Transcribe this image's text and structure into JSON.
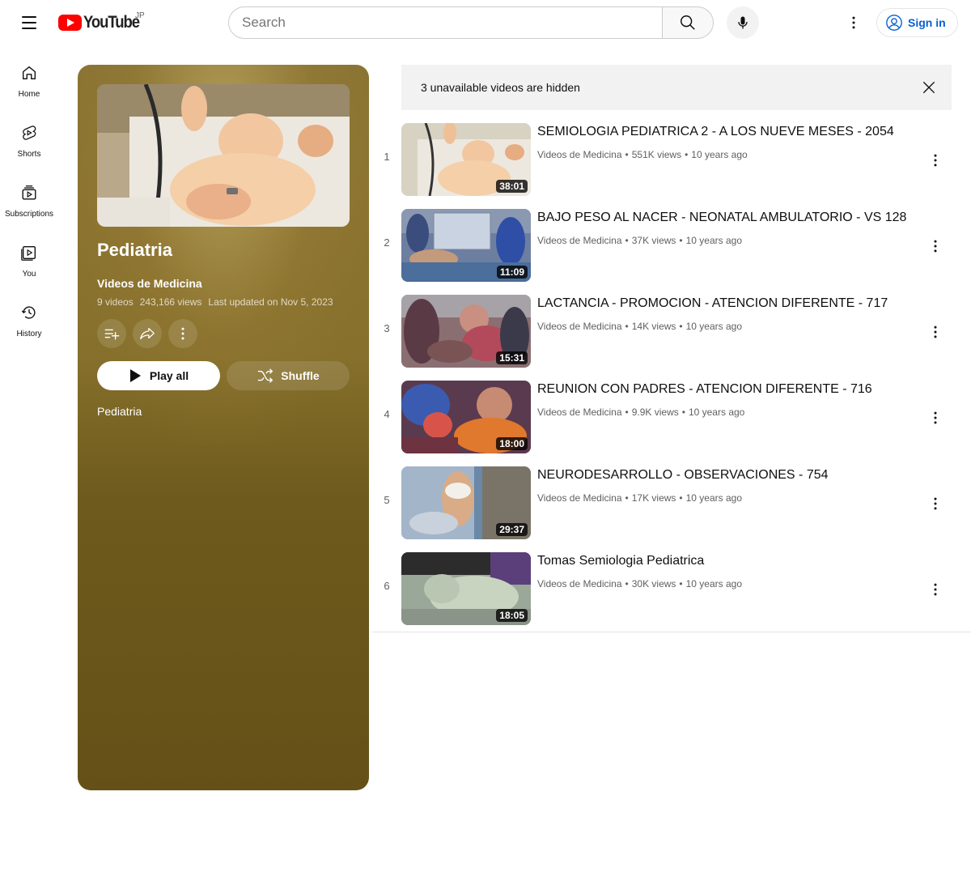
{
  "masthead": {
    "logo_text": "YouTube",
    "country_code": "JP",
    "search_placeholder": "Search",
    "signin_label": "Sign in"
  },
  "guide": {
    "items": [
      {
        "label": "Home",
        "icon": "home-icon"
      },
      {
        "label": "Shorts",
        "icon": "shorts-icon"
      },
      {
        "label": "Subscriptions",
        "icon": "subscriptions-icon"
      },
      {
        "label": "You",
        "icon": "you-icon"
      },
      {
        "label": "History",
        "icon": "history-icon"
      }
    ]
  },
  "playlist": {
    "title": "Pediatria",
    "channel": "Videos de Medicina",
    "video_count": "9 videos",
    "views": "243,166 views",
    "last_updated": "Last updated on Nov 5, 2023",
    "play_all_label": "Play all",
    "shuffle_label": "Shuffle",
    "description": "Pediatria"
  },
  "alert": {
    "text": "3 unavailable videos are hidden"
  },
  "videos": [
    {
      "index": "1",
      "title": "SEMIOLOGIA PEDIATRICA 2 - A LOS NUEVE MESES - 2054",
      "channel": "Videos de Medicina",
      "views": "551K views",
      "age": "10 years ago",
      "duration": "38:01"
    },
    {
      "index": "2",
      "title": "BAJO PESO AL NACER - NEONATAL AMBULATORIO - VS 128",
      "channel": "Videos de Medicina",
      "views": "37K views",
      "age": "10 years ago",
      "duration": "11:09"
    },
    {
      "index": "3",
      "title": "LACTANCIA - PROMOCION - ATENCION DIFERENTE - 717",
      "channel": "Videos de Medicina",
      "views": "14K views",
      "age": "10 years ago",
      "duration": "15:31"
    },
    {
      "index": "4",
      "title": "REUNION CON PADRES - ATENCION DIFERENTE - 716",
      "channel": "Videos de Medicina",
      "views": "9.9K views",
      "age": "10 years ago",
      "duration": "18:00"
    },
    {
      "index": "5",
      "title": "NEURODESARROLLO - OBSERVACIONES - 754",
      "channel": "Videos de Medicina",
      "views": "17K views",
      "age": "10 years ago",
      "duration": "29:37"
    },
    {
      "index": "6",
      "title": "Tomas Semiologia Pediatrica",
      "channel": "Videos de Medicina",
      "views": "30K views",
      "age": "10 years ago",
      "duration": "18:05"
    }
  ],
  "colors": {
    "brand_red": "#ff0000",
    "link_blue": "#065fd4",
    "panel_gold": "#8a7433"
  }
}
